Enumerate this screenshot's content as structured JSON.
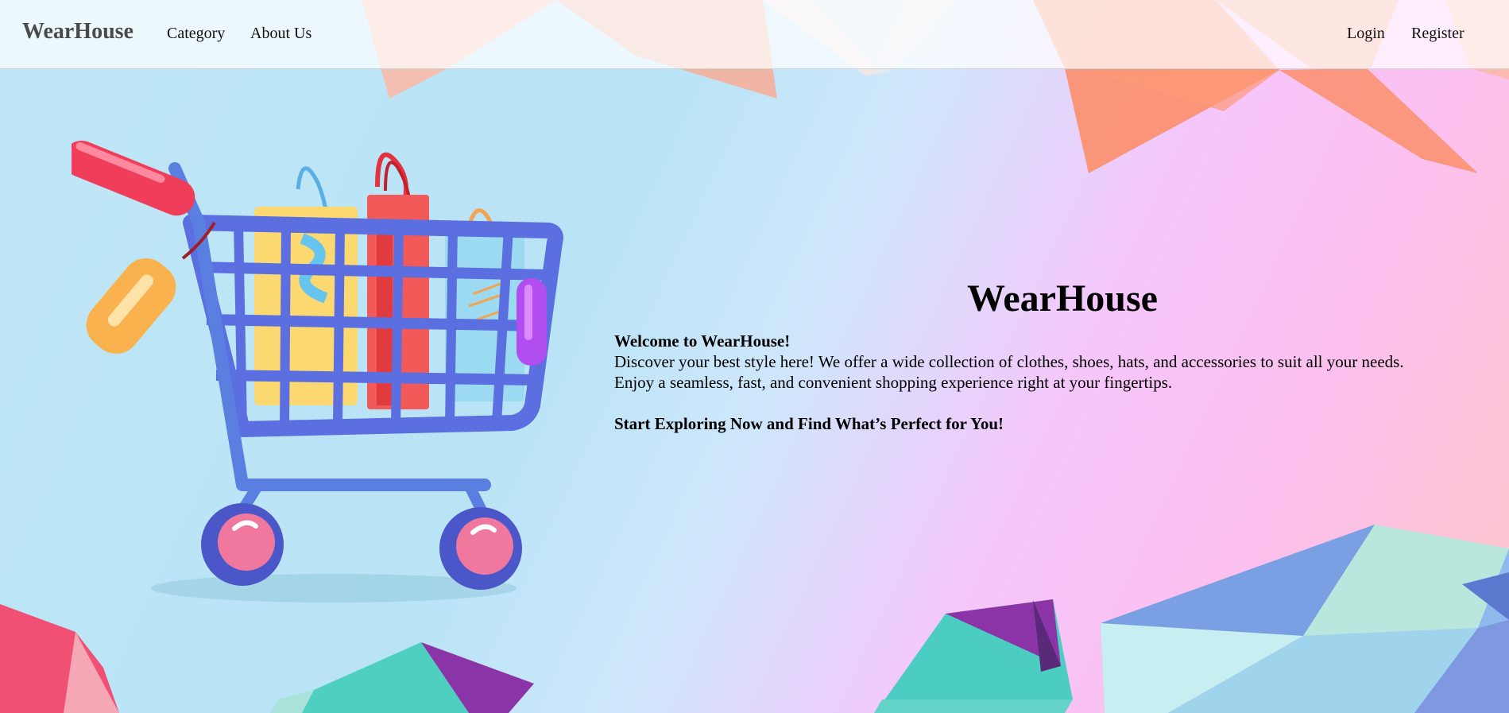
{
  "navbar": {
    "brand": "WearHouse",
    "links": {
      "category": "Category",
      "about": "About Us",
      "login": "Login",
      "register": "Register"
    }
  },
  "hero": {
    "title": "WearHouse",
    "welcome": "Welcome to WearHouse!",
    "line1": "Discover your best style here! We offer a wide collection of clothes, shoes, hats, and accessories to suit all your needs.",
    "line2": "Enjoy a seamless, fast, and convenient shopping experience right at your fingertips.",
    "cta": "Start Exploring Now and Find What’s Perfect for You!"
  },
  "illustration": {
    "subject": "shopping-cart-with-bags",
    "colors": {
      "cart": "#5b6fe0",
      "handle": "#ef3d5a",
      "tag": "#f9b24e",
      "wheel": "#f0789f",
      "bag_red": "#f25a5a",
      "bag_yellow": "#fbd870",
      "bag_blue": "#8fd6f0"
    }
  },
  "theme": {
    "bg_blue": "#b9e4f6",
    "bg_pink": "#fcc0ee",
    "accent_coral": "#fb8f6b",
    "accent_teal": "#4bcdc2",
    "accent_purple": "#8a34a8"
  }
}
